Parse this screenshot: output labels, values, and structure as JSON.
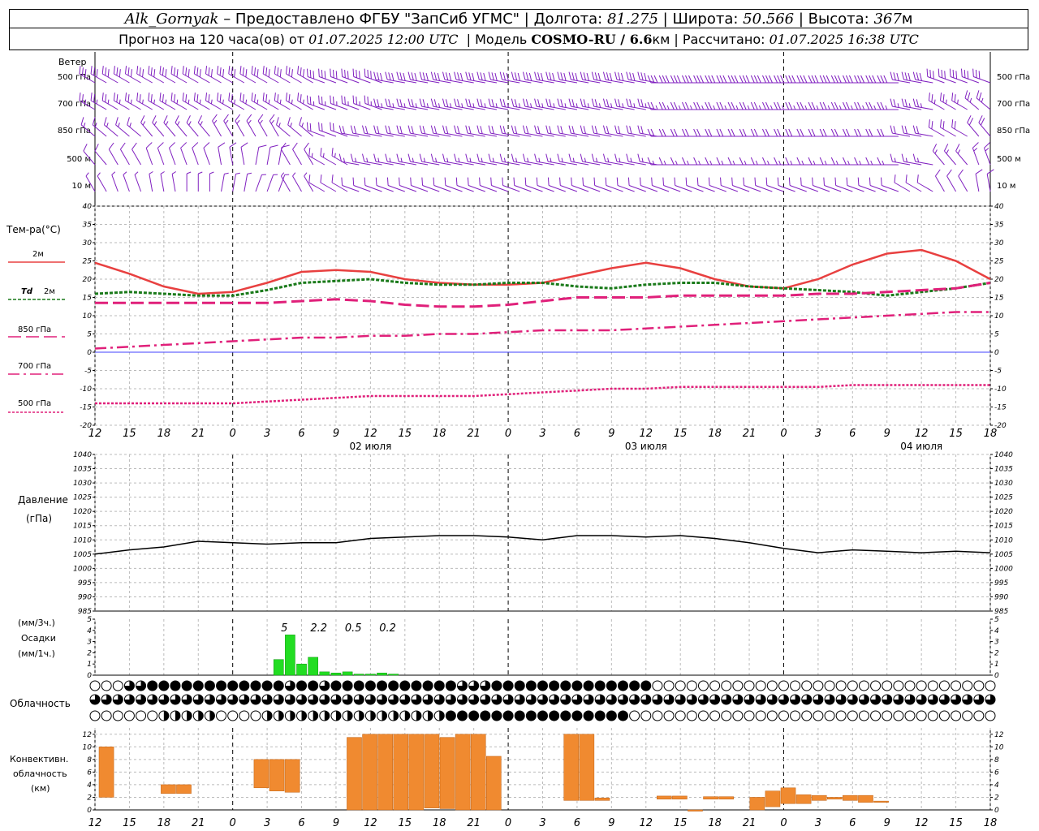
{
  "header": {
    "station": "Alk_Gornyak",
    "provider": "Предоставлено ФГБУ \"ЗапСиб УГМС\"",
    "lon_label": "Долгота:",
    "lon_value": "81.275",
    "lat_label": "Широта:",
    "lat_value": "50.566",
    "alt_label": "Высота:",
    "alt_value": "367",
    "alt_unit": "м",
    "forecast_prefix": "Прогноз на 120 часа(ов) от",
    "forecast_time": "01.07.2025 12:00 UTC",
    "model_label": "Модель",
    "model_name": "COSMO-RU / 6.6",
    "model_unit": "км",
    "calc_label": "Рассчитано:",
    "calc_time": "01.07.2025 16:38 UTC"
  },
  "time_axis": {
    "hour_ticks": [
      "12",
      "15",
      "18",
      "21",
      "0",
      "3",
      "6",
      "9",
      "12",
      "15",
      "18",
      "21",
      "0",
      "3",
      "6",
      "9",
      "12",
      "15",
      "18",
      "21",
      "0",
      "3",
      "6",
      "9",
      "12",
      "15",
      "18"
    ],
    "date_labels": [
      {
        "label": "02 июля",
        "hour": 24
      },
      {
        "label": "03 июля",
        "hour": 48
      },
      {
        "label": "04 июля",
        "hour": 72
      }
    ]
  },
  "labels": {
    "wind": "Ветер",
    "wind_levels": [
      "500 гПа",
      "700 гПа",
      "850 гПа",
      "500 м",
      "10 м"
    ],
    "wind_levels_right": [
      "500 гПа",
      "700 гПа",
      "850 гПа",
      "500 м",
      "10 м"
    ],
    "temp_title": "Тем-ра(°C)",
    "legend_2m": "2м",
    "legend_td": "Td",
    "legend_td2": "2м",
    "legend_850": "850 гПа",
    "legend_700": "700 гПа",
    "legend_500": "500 гПа",
    "pressure_title": "Давление",
    "pressure_unit": "(гПа)",
    "precip_unit1": "(мм/3ч.)",
    "precip_title": "Осадки",
    "precip_unit2": "(мм/1ч.)",
    "cloud_title": "Облачность",
    "conv_title1": "Конвективн.",
    "conv_title2": "облачность",
    "conv_unit": "(км)"
  },
  "colors": {
    "t2m": "#e84040",
    "td2m": "#1a7a1a",
    "t850": "#e0207a",
    "t700": "#e0207a",
    "t500": "#e0207a",
    "wind": "#8020c0",
    "precip": "#22dd22",
    "conv": "#f08a30",
    "pressure": "#000000",
    "zero_line": "#4040ff"
  },
  "chart_data": [
    {
      "type": "line",
      "title": "Тем-ра(°C)",
      "ylim": [
        -20,
        40
      ],
      "yticks": [
        -20,
        -15,
        -10,
        -5,
        0,
        5,
        10,
        15,
        20,
        25,
        30,
        35,
        40
      ],
      "x": [
        0,
        3,
        6,
        9,
        12,
        15,
        18,
        21,
        24,
        27,
        30,
        33,
        36,
        39,
        42,
        45,
        48,
        51,
        54,
        57,
        60,
        63,
        66,
        69,
        72,
        75,
        78
      ],
      "series": [
        {
          "name": "2м",
          "values": [
            24.5,
            21.5,
            18,
            16,
            16.5,
            19,
            22,
            22.5,
            22,
            20,
            19,
            18.5,
            18.5,
            19,
            21,
            23,
            24.5,
            23,
            20,
            18,
            17.5,
            20,
            24,
            27,
            28,
            25,
            20
          ]
        },
        {
          "name": "Td 2м",
          "values": [
            16,
            16.5,
            16,
            15.5,
            15.5,
            17,
            19,
            19.5,
            20,
            19,
            18.5,
            18.5,
            19,
            19,
            18,
            17.5,
            18.5,
            19,
            19,
            18,
            17.5,
            17,
            16.5,
            15.5,
            16.5,
            17.5,
            19
          ]
        },
        {
          "name": "850 гПа",
          "values": [
            13.5,
            13.5,
            13.5,
            13.5,
            13.5,
            13.5,
            14,
            14.5,
            14,
            13,
            12.5,
            12.5,
            13,
            14,
            15,
            15,
            15,
            15.5,
            15.5,
            15.5,
            15.5,
            16,
            16,
            16.5,
            17,
            17.5,
            19
          ]
        },
        {
          "name": "700 гПа",
          "values": [
            1,
            1.5,
            2,
            2.5,
            3,
            3.5,
            4,
            4,
            4.5,
            4.5,
            5,
            5,
            5.5,
            6,
            6,
            6,
            6.5,
            7,
            7.5,
            8,
            8.5,
            9,
            9.5,
            10,
            10.5,
            11,
            11
          ]
        },
        {
          "name": "500 гПа",
          "values": [
            -14,
            -14,
            -14,
            -14,
            -14,
            -13.5,
            -13,
            -12.5,
            -12,
            -12,
            -12,
            -12,
            -11.5,
            -11,
            -10.5,
            -10,
            -10,
            -9.5,
            -9.5,
            -9.5,
            -9.5,
            -9.5,
            -9,
            -9,
            -9,
            -9,
            -9
          ]
        }
      ]
    },
    {
      "type": "line",
      "title": "Давление",
      "ylim": [
        985,
        1040
      ],
      "yticks": [
        985,
        990,
        995,
        1000,
        1005,
        1010,
        1015,
        1020,
        1025,
        1030,
        1035,
        1040
      ],
      "x": [
        0,
        3,
        6,
        9,
        12,
        15,
        18,
        21,
        24,
        27,
        30,
        33,
        36,
        39,
        42,
        45,
        48,
        51,
        54,
        57,
        60,
        63,
        66,
        69,
        72,
        75,
        78
      ],
      "series": [
        {
          "name": "Давление",
          "values": [
            1005,
            1006.5,
            1007.5,
            1009.5,
            1009,
            1008.5,
            1009,
            1009,
            1010.5,
            1011,
            1011.5,
            1011.5,
            1011,
            1010,
            1011.5,
            1011.5,
            1011,
            1011.5,
            1010.5,
            1009,
            1007,
            1005.5,
            1006.5,
            1006,
            1005.5,
            1006,
            1005.5
          ]
        }
      ]
    },
    {
      "type": "bar",
      "title": "Осадки",
      "ylim": [
        0,
        5
      ],
      "yticks": [
        0,
        1,
        2,
        3,
        4,
        5
      ],
      "x": [
        16,
        17,
        18,
        19,
        20,
        21,
        22,
        23,
        24,
        25,
        26
      ],
      "values": [
        1.4,
        3.6,
        1.0,
        1.6,
        0.3,
        0.2,
        0.3,
        0.1,
        0.1,
        0.2,
        0.1
      ],
      "annotations": [
        {
          "hour": 16.5,
          "text": "5"
        },
        {
          "hour": 19.5,
          "text": "2.2"
        },
        {
          "hour": 22.5,
          "text": "0.5"
        },
        {
          "hour": 25.5,
          "text": "0.2"
        }
      ]
    },
    {
      "type": "bar",
      "title": "Конвективн. облачность",
      "ylim": [
        0,
        13
      ],
      "yticks": [
        0,
        2,
        4,
        6,
        8,
        10,
        12
      ],
      "bars": [
        {
          "x": 0,
          "bottom": 2,
          "top": 10
        },
        {
          "x": 4,
          "bottom": 2.6,
          "top": 4
        },
        {
          "x": 5,
          "bottom": 2.6,
          "top": 4
        },
        {
          "x": 10,
          "bottom": 3.5,
          "top": 8
        },
        {
          "x": 11,
          "bottom": 3,
          "top": 8
        },
        {
          "x": 12,
          "bottom": 2.8,
          "top": 8
        },
        {
          "x": 16,
          "bottom": 0,
          "top": 11.5
        },
        {
          "x": 17,
          "bottom": 0,
          "top": 12
        },
        {
          "x": 18,
          "bottom": 0,
          "top": 12
        },
        {
          "x": 19,
          "bottom": 0,
          "top": 12
        },
        {
          "x": 20,
          "bottom": 0,
          "top": 12
        },
        {
          "x": 21,
          "bottom": 0.3,
          "top": 12
        },
        {
          "x": 22,
          "bottom": 0.2,
          "top": 11.5
        },
        {
          "x": 23,
          "bottom": 0,
          "top": 12
        },
        {
          "x": 24,
          "bottom": 0,
          "top": 12
        },
        {
          "x": 25,
          "bottom": 0,
          "top": 8.5
        },
        {
          "x": 30,
          "bottom": 1.5,
          "top": 12
        },
        {
          "x": 31,
          "bottom": 1.5,
          "top": 12
        },
        {
          "x": 32,
          "bottom": 1.5,
          "top": 1.9
        },
        {
          "x": 36,
          "bottom": 1.7,
          "top": 2.2
        },
        {
          "x": 37,
          "bottom": 1.7,
          "top": 2.2
        },
        {
          "x": 38,
          "bottom": -0.2,
          "top": 0
        },
        {
          "x": 39,
          "bottom": 1.7,
          "top": 2.1
        },
        {
          "x": 40,
          "bottom": 1.7,
          "top": 2.1
        },
        {
          "x": 42,
          "bottom": 0,
          "top": 2
        },
        {
          "x": 43,
          "bottom": 0.5,
          "top": 3
        },
        {
          "x": 44,
          "bottom": 1,
          "top": 3.5
        },
        {
          "x": 45,
          "bottom": 1,
          "top": 2.4
        },
        {
          "x": 46,
          "bottom": 1.5,
          "top": 2.3
        },
        {
          "x": 47,
          "bottom": 1.7,
          "top": 2
        },
        {
          "x": 48,
          "bottom": 1.5,
          "top": 2.3
        },
        {
          "x": 49,
          "bottom": 1.2,
          "top": 2.3
        },
        {
          "x": 50,
          "bottom": 1.2,
          "top": 1.4
        }
      ]
    }
  ],
  "wind_data": {
    "levels": [
      "500 гПа",
      "700 гПа",
      "850 гПа",
      "500 м",
      "10 м"
    ],
    "direction_from_deg": [
      [
        300,
        300,
        300,
        300,
        300,
        300,
        300,
        290,
        290,
        280,
        280,
        280,
        280,
        280,
        280,
        280,
        280,
        270,
        270,
        270,
        270,
        270,
        270,
        270,
        280,
        290,
        290
      ],
      [
        300,
        300,
        300,
        300,
        300,
        300,
        300,
        290,
        290,
        280,
        280,
        280,
        280,
        280,
        280,
        280,
        280,
        270,
        270,
        270,
        270,
        270,
        270,
        270,
        280,
        300,
        310
      ],
      [
        310,
        310,
        320,
        320,
        330,
        330,
        310,
        290,
        280,
        280,
        280,
        280,
        280,
        280,
        280,
        280,
        280,
        270,
        270,
        270,
        270,
        270,
        270,
        270,
        280,
        300,
        320
      ],
      [
        320,
        330,
        340,
        340,
        350,
        10,
        330,
        300,
        280,
        280,
        280,
        280,
        280,
        280,
        280,
        280,
        280,
        270,
        270,
        270,
        270,
        270,
        270,
        270,
        280,
        320,
        340
      ],
      [
        330,
        340,
        350,
        0,
        10,
        20,
        330,
        300,
        290,
        290,
        290,
        290,
        290,
        290,
        290,
        290,
        290,
        290,
        290,
        290,
        290,
        290,
        290,
        290,
        300,
        330,
        350
      ]
    ],
    "speed_ms": [
      [
        15,
        15,
        15,
        15,
        15,
        15,
        15,
        15,
        15,
        15,
        15,
        15,
        15,
        15,
        15,
        15,
        15,
        15,
        15,
        15,
        15,
        15,
        15,
        15,
        15,
        15,
        15
      ],
      [
        12,
        12,
        12,
        12,
        12,
        12,
        12,
        12,
        12,
        12,
        12,
        12,
        12,
        12,
        12,
        12,
        12,
        12,
        12,
        12,
        12,
        12,
        12,
        12,
        12,
        12,
        12
      ],
      [
        8,
        8,
        8,
        8,
        8,
        8,
        8,
        10,
        10,
        10,
        10,
        10,
        10,
        10,
        10,
        10,
        10,
        10,
        10,
        10,
        10,
        10,
        10,
        10,
        10,
        10,
        10
      ],
      [
        5,
        5,
        5,
        5,
        5,
        5,
        5,
        8,
        8,
        8,
        8,
        8,
        8,
        8,
        8,
        8,
        8,
        8,
        8,
        8,
        8,
        8,
        8,
        8,
        8,
        8,
        8
      ],
      [
        3,
        3,
        3,
        3,
        3,
        3,
        3,
        5,
        5,
        5,
        5,
        5,
        5,
        5,
        5,
        5,
        5,
        5,
        5,
        5,
        5,
        5,
        5,
        5,
        5,
        5,
        5
      ]
    ]
  },
  "cloud_data": {
    "rows": [
      "0003344444444444434434444444444433344444444444444000000000000000000000000000000",
      "3333333333333333333333333333333333333333333333333333333333333333333333333333333",
      "0000002222200002222222222222222444444444444444400000000000000000000000000000000"
    ]
  }
}
